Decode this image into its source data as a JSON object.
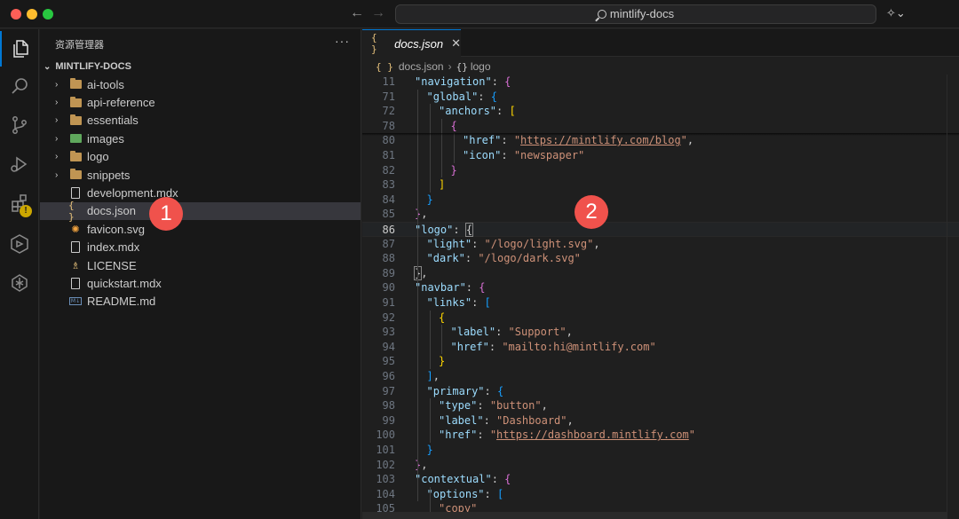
{
  "window": {
    "search_text": "mintlify-docs"
  },
  "sidebar": {
    "header": "资源管理器",
    "more": "···",
    "root": "MINTLIFY-DOCS",
    "items": [
      {
        "label": "ai-tools",
        "type": "folder"
      },
      {
        "label": "api-reference",
        "type": "folder"
      },
      {
        "label": "essentials",
        "type": "folder"
      },
      {
        "label": "images",
        "type": "image-folder"
      },
      {
        "label": "logo",
        "type": "folder"
      },
      {
        "label": "snippets",
        "type": "folder"
      },
      {
        "label": "development.mdx",
        "type": "file"
      },
      {
        "label": "docs.json",
        "type": "json"
      },
      {
        "label": "favicon.svg",
        "type": "svg"
      },
      {
        "label": "index.mdx",
        "type": "file"
      },
      {
        "label": "LICENSE",
        "type": "license"
      },
      {
        "label": "quickstart.mdx",
        "type": "file"
      },
      {
        "label": "README.md",
        "type": "md"
      }
    ]
  },
  "editor": {
    "tab_label": "docs.json",
    "tab_icon": "{ }",
    "breadcrumb": [
      "docs.json",
      "logo"
    ],
    "current_line": "86",
    "lines": [
      {
        "n": "11",
        "i": 0,
        "t": [
          [
            "k",
            "\"navigation\""
          ],
          [
            "p",
            ": "
          ],
          [
            "b2",
            "{"
          ]
        ]
      },
      {
        "n": "71",
        "i": 1,
        "t": [
          [
            "k",
            "\"global\""
          ],
          [
            "p",
            ": "
          ],
          [
            "b3",
            "{"
          ]
        ]
      },
      {
        "n": "72",
        "i": 2,
        "t": [
          [
            "k",
            "\"anchors\""
          ],
          [
            "p",
            ": "
          ],
          [
            "b1",
            "["
          ]
        ]
      },
      {
        "n": "78",
        "i": 3,
        "t": [
          [
            "b2",
            "{"
          ]
        ]
      },
      {
        "n": "80",
        "i": 4,
        "t": [
          [
            "k",
            "\"href\""
          ],
          [
            "p",
            ": "
          ],
          [
            "s",
            "\""
          ],
          [
            "u",
            "https://mintlify.com/blog"
          ],
          [
            "s",
            "\""
          ],
          [
            "p",
            ","
          ]
        ]
      },
      {
        "n": "81",
        "i": 4,
        "t": [
          [
            "k",
            "\"icon\""
          ],
          [
            "p",
            ": "
          ],
          [
            "s",
            "\"newspaper\""
          ]
        ]
      },
      {
        "n": "82",
        "i": 3,
        "t": [
          [
            "b2",
            "}"
          ]
        ]
      },
      {
        "n": "83",
        "i": 2,
        "t": [
          [
            "b1",
            "]"
          ]
        ]
      },
      {
        "n": "84",
        "i": 1,
        "t": [
          [
            "b3",
            "}"
          ]
        ]
      },
      {
        "n": "85",
        "i": 0,
        "t": [
          [
            "b2",
            "}"
          ],
          [
            "p",
            ","
          ]
        ]
      },
      {
        "n": "86",
        "i": 0,
        "t": [
          [
            "k",
            "\"logo\""
          ],
          [
            "p",
            ": "
          ],
          [
            "bm",
            "{"
          ]
        ]
      },
      {
        "n": "87",
        "i": 1,
        "t": [
          [
            "k",
            "\"light\""
          ],
          [
            "p",
            ": "
          ],
          [
            "s",
            "\"/logo/light.svg\""
          ],
          [
            "p",
            ","
          ]
        ]
      },
      {
        "n": "88",
        "i": 1,
        "t": [
          [
            "k",
            "\"dark\""
          ],
          [
            "p",
            ": "
          ],
          [
            "s",
            "\"/logo/dark.svg\""
          ]
        ]
      },
      {
        "n": "89",
        "i": 0,
        "t": [
          [
            "bm",
            "}"
          ],
          [
            "p",
            ","
          ]
        ]
      },
      {
        "n": "90",
        "i": 0,
        "t": [
          [
            "k",
            "\"navbar\""
          ],
          [
            "p",
            ": "
          ],
          [
            "b2",
            "{"
          ]
        ]
      },
      {
        "n": "91",
        "i": 1,
        "t": [
          [
            "k",
            "\"links\""
          ],
          [
            "p",
            ": "
          ],
          [
            "b3",
            "["
          ]
        ]
      },
      {
        "n": "92",
        "i": 2,
        "t": [
          [
            "b1",
            "{"
          ]
        ]
      },
      {
        "n": "93",
        "i": 3,
        "t": [
          [
            "k",
            "\"label\""
          ],
          [
            "p",
            ": "
          ],
          [
            "s",
            "\"Support\""
          ],
          [
            "p",
            ","
          ]
        ]
      },
      {
        "n": "94",
        "i": 3,
        "t": [
          [
            "k",
            "\"href\""
          ],
          [
            "p",
            ": "
          ],
          [
            "s",
            "\"mailto:hi@mintlify.com\""
          ]
        ]
      },
      {
        "n": "95",
        "i": 2,
        "t": [
          [
            "b1",
            "}"
          ]
        ]
      },
      {
        "n": "96",
        "i": 1,
        "t": [
          [
            "b3",
            "]"
          ],
          [
            "p",
            ","
          ]
        ]
      },
      {
        "n": "97",
        "i": 1,
        "t": [
          [
            "k",
            "\"primary\""
          ],
          [
            "p",
            ": "
          ],
          [
            "b3",
            "{"
          ]
        ]
      },
      {
        "n": "98",
        "i": 2,
        "t": [
          [
            "k",
            "\"type\""
          ],
          [
            "p",
            ": "
          ],
          [
            "s",
            "\"button\""
          ],
          [
            "p",
            ","
          ]
        ]
      },
      {
        "n": "99",
        "i": 2,
        "t": [
          [
            "k",
            "\"label\""
          ],
          [
            "p",
            ": "
          ],
          [
            "s",
            "\"Dashboard\""
          ],
          [
            "p",
            ","
          ]
        ]
      },
      {
        "n": "100",
        "i": 2,
        "t": [
          [
            "k",
            "\"href\""
          ],
          [
            "p",
            ": "
          ],
          [
            "s",
            "\""
          ],
          [
            "u",
            "https://dashboard.mintlify.com"
          ],
          [
            "s",
            "\""
          ]
        ]
      },
      {
        "n": "101",
        "i": 1,
        "t": [
          [
            "b3",
            "}"
          ]
        ]
      },
      {
        "n": "102",
        "i": 0,
        "t": [
          [
            "b2",
            "}"
          ],
          [
            "p",
            ","
          ]
        ]
      },
      {
        "n": "103",
        "i": 0,
        "t": [
          [
            "k",
            "\"contextual\""
          ],
          [
            "p",
            ": "
          ],
          [
            "b2",
            "{"
          ]
        ]
      },
      {
        "n": "104",
        "i": 1,
        "t": [
          [
            "k",
            "\"options\""
          ],
          [
            "p",
            ": "
          ],
          [
            "b3",
            "["
          ]
        ]
      },
      {
        "n": "105",
        "i": 2,
        "t": [
          [
            "s",
            "\"copy\""
          ]
        ]
      }
    ]
  },
  "callouts": [
    "1",
    "2"
  ],
  "colors": {
    "accent": "#0078d4",
    "callout": "#f0524c",
    "selected_row": "#37373d"
  }
}
